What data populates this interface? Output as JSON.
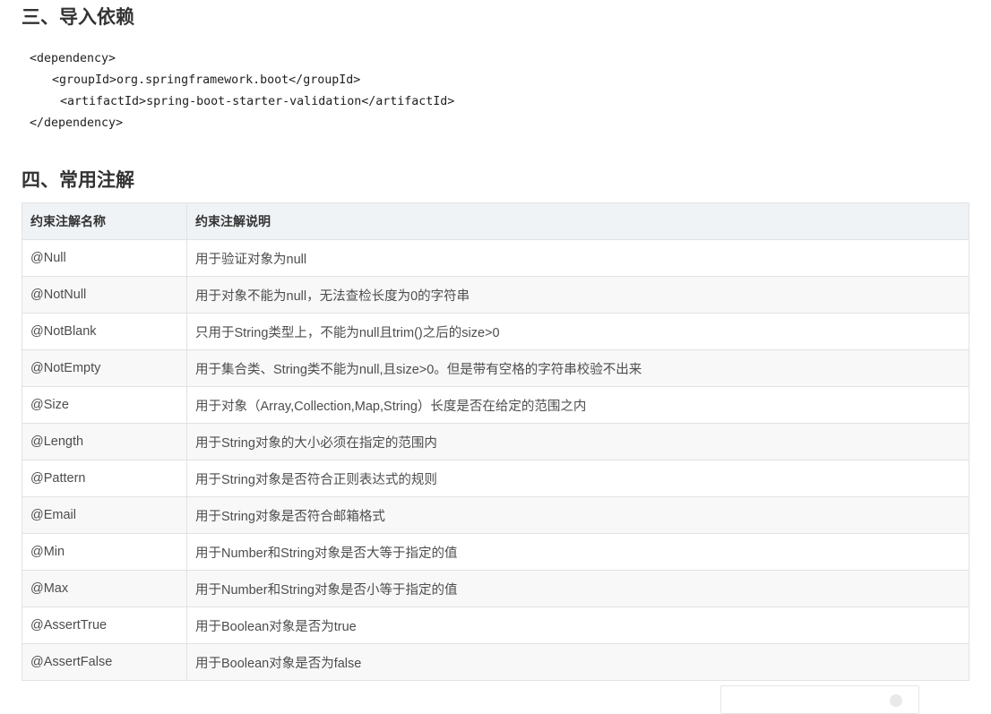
{
  "section_import": {
    "title": "三、导入依赖",
    "code_lines": [
      "<dependency>",
      "<groupId>org.springframework.boot</groupId>",
      "<artifactId>spring-boot-starter-validation</artifactId>",
      "</dependency>"
    ]
  },
  "section_annotations": {
    "title": "四、常用注解",
    "headers": [
      "约束注解名称",
      "约束注解说明"
    ],
    "rows": [
      {
        "name": "@Null",
        "desc": "用于验证对象为null"
      },
      {
        "name": "@NotNull",
        "desc": "用于对象不能为null，无法查检长度为0的字符串"
      },
      {
        "name": "@NotBlank",
        "desc": "只用于String类型上，不能为null且trim()之后的size>0"
      },
      {
        "name": "@NotEmpty",
        "desc": "用于集合类、String类不能为null,且size>0。但是带有空格的字符串校验不出来"
      },
      {
        "name": "@Size",
        "desc": "用于对象（Array,Collection,Map,String）长度是否在给定的范围之内"
      },
      {
        "name": "@Length",
        "desc": "用于String对象的大小必须在指定的范围内"
      },
      {
        "name": "@Pattern",
        "desc": "用于String对象是否符合正则表达式的规则"
      },
      {
        "name": "@Email",
        "desc": "用于String对象是否符合邮箱格式"
      },
      {
        "name": "@Min",
        "desc": "用于Number和String对象是否大等于指定的值"
      },
      {
        "name": "@Max",
        "desc": "用于Number和String对象是否小等于指定的值"
      },
      {
        "name": "@AssertTrue",
        "desc": "用于Boolean对象是否为true"
      },
      {
        "name": "@AssertFalse",
        "desc": "用于Boolean对象是否为false"
      }
    ]
  }
}
